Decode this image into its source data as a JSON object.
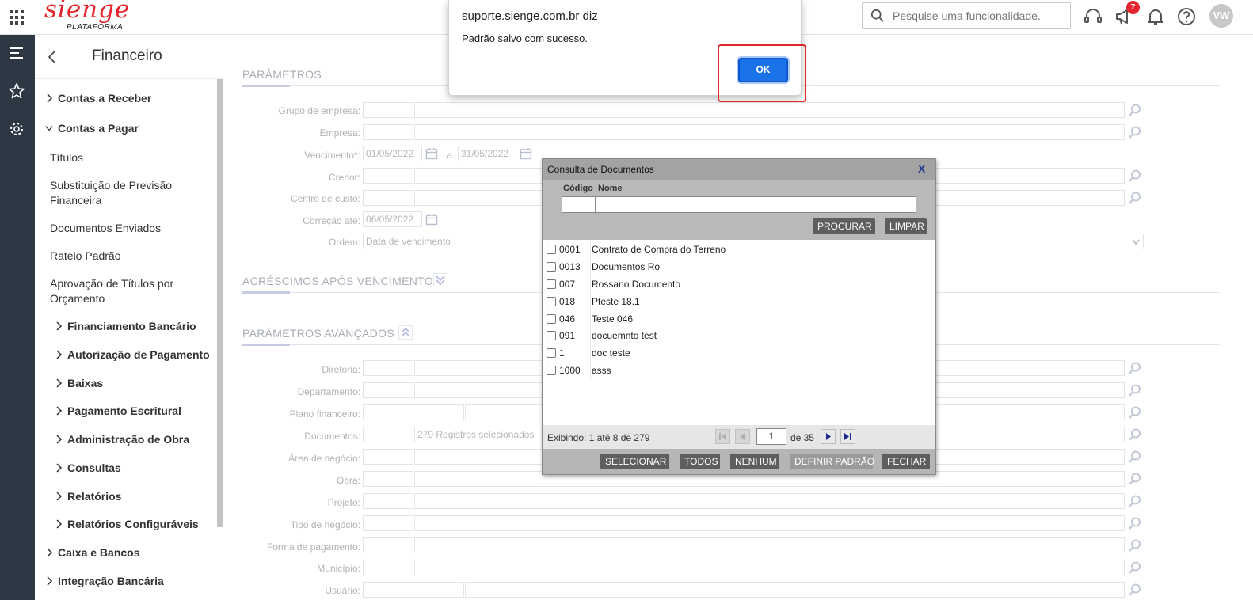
{
  "topbar": {
    "logo_main": "sienge",
    "logo_sub": "PLATAFORMA",
    "search_placeholder": "Pesquise uma funcionalidade.",
    "notification_count": "7",
    "avatar_initials": "VW"
  },
  "sidemenu": {
    "title": "Financeiro",
    "items": [
      {
        "label": "Contas a Receber",
        "chevron": "right"
      },
      {
        "label": "Contas a Pagar",
        "chevron": "down"
      },
      {
        "label": "Títulos"
      },
      {
        "label": "Substituição de Previsão",
        "label2": "Financeira"
      },
      {
        "label": "Documentos Enviados"
      },
      {
        "label": "Rateio Padrão"
      },
      {
        "label": "Aprovação de Títulos por",
        "label2": "Orçamento"
      },
      {
        "label": "Financiamento Bancário",
        "chevron": "right"
      },
      {
        "label": "Autorização de Pagamento",
        "chevron": "right"
      },
      {
        "label": "Baixas",
        "chevron": "right"
      },
      {
        "label": "Pagamento Escritural",
        "chevron": "right"
      },
      {
        "label": "Administração de Obra",
        "chevron": "right"
      },
      {
        "label": "Consultas",
        "chevron": "right"
      },
      {
        "label": "Relatórios",
        "chevron": "right"
      },
      {
        "label": "Relatórios Configuráveis",
        "chevron": "right"
      },
      {
        "label": "Caixa e Bancos",
        "chevron": "right"
      },
      {
        "label": "Integração Bancária",
        "chevron": "right"
      }
    ]
  },
  "main": {
    "section_params": "PARÂMETROS",
    "section_acrescimos": "ACRÉSCIMOS APÓS VENCIMENTO",
    "section_advanced": "PARÂMETROS AVANÇADOS",
    "fields": {
      "grupo_empresa": "Grupo de empresa:",
      "empresa": "Empresa:",
      "vencimento": "Vencimento*:",
      "vencimento_from": "01/05/2022",
      "vencimento_sep": "a",
      "vencimento_to": "31/05/2022",
      "credor": "Credor:",
      "centro_custo": "Centro de custo:",
      "correcao_ate": "Correção até:",
      "correcao_value": "06/05/2022",
      "ordem": "Ordem:",
      "ordem_value": "Data de vencimento",
      "diretoria": "Diretoria:",
      "departamento": "Departamento:",
      "plano_financeiro": "Plano financeiro:",
      "documentos": "Documentos:",
      "documentos_value": "279 Registros selecionados",
      "area_negocio": "Área de negócio:",
      "obra": "Obra:",
      "projeto": "Projeto:",
      "tipo_negocio": "Tipo de negócio:",
      "forma_pagamento": "Forma de pagamento:",
      "municipio": "Município:",
      "usuario": "Usuário:"
    }
  },
  "dialog": {
    "title": "Consulta de Documentos",
    "close": "X",
    "col_code": "Código",
    "col_name": "Nome",
    "btn_search": "PROCURAR",
    "btn_clear": "LIMPAR",
    "rows": [
      {
        "code": "0001",
        "name": "Contrato de Compra do Terreno"
      },
      {
        "code": "0013",
        "name": "Documentos Ro"
      },
      {
        "code": "007",
        "name": "Rossano Documento"
      },
      {
        "code": "018",
        "name": "Pteste 18.1"
      },
      {
        "code": "046",
        "name": "Teste 046"
      },
      {
        "code": "091",
        "name": "docuemnto test"
      },
      {
        "code": "1",
        "name": "doc teste"
      },
      {
        "code": "1000",
        "name": "asss"
      }
    ],
    "pager_text": "Exibindo: 1 até 8 de 279",
    "page_value": "1",
    "page_of": "de 35",
    "btn_select": "SELECIONAR",
    "btn_all": "TODOS",
    "btn_none": "NENHUM",
    "btn_default": "DEFINIR PADRÃO",
    "btn_close": "FECHAR"
  },
  "alert": {
    "title": "suporte.sienge.com.br diz",
    "message": "Padrão salvo com sucesso.",
    "ok_label": "OK"
  }
}
